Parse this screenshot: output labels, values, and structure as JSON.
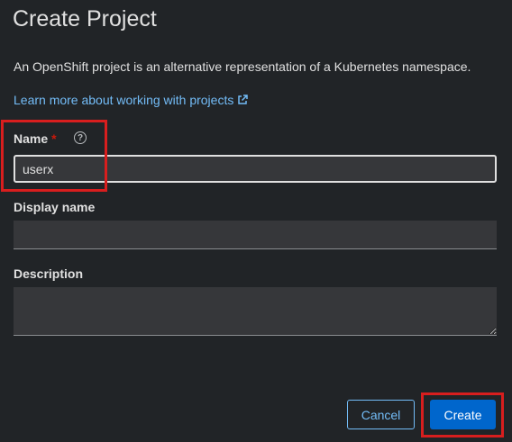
{
  "page": {
    "title": "Create Project",
    "description": "An OpenShift project is an alternative representation of a Kubernetes namespace.",
    "learn_more_link": "Learn more about working with projects",
    "external_link_icon": "external-link-icon",
    "help_icon_glyph": "?"
  },
  "form": {
    "name": {
      "label": "Name",
      "required_marker": "*",
      "value": "userx"
    },
    "display_name": {
      "label": "Display name",
      "value": ""
    },
    "description": {
      "label": "Description",
      "value": ""
    }
  },
  "actions": {
    "cancel_label": "Cancel",
    "create_label": "Create"
  },
  "colors": {
    "background": "#212427",
    "link": "#73bcf7",
    "primary": "#0066cc",
    "required": "#c9190b",
    "highlight": "#d81e1e"
  }
}
